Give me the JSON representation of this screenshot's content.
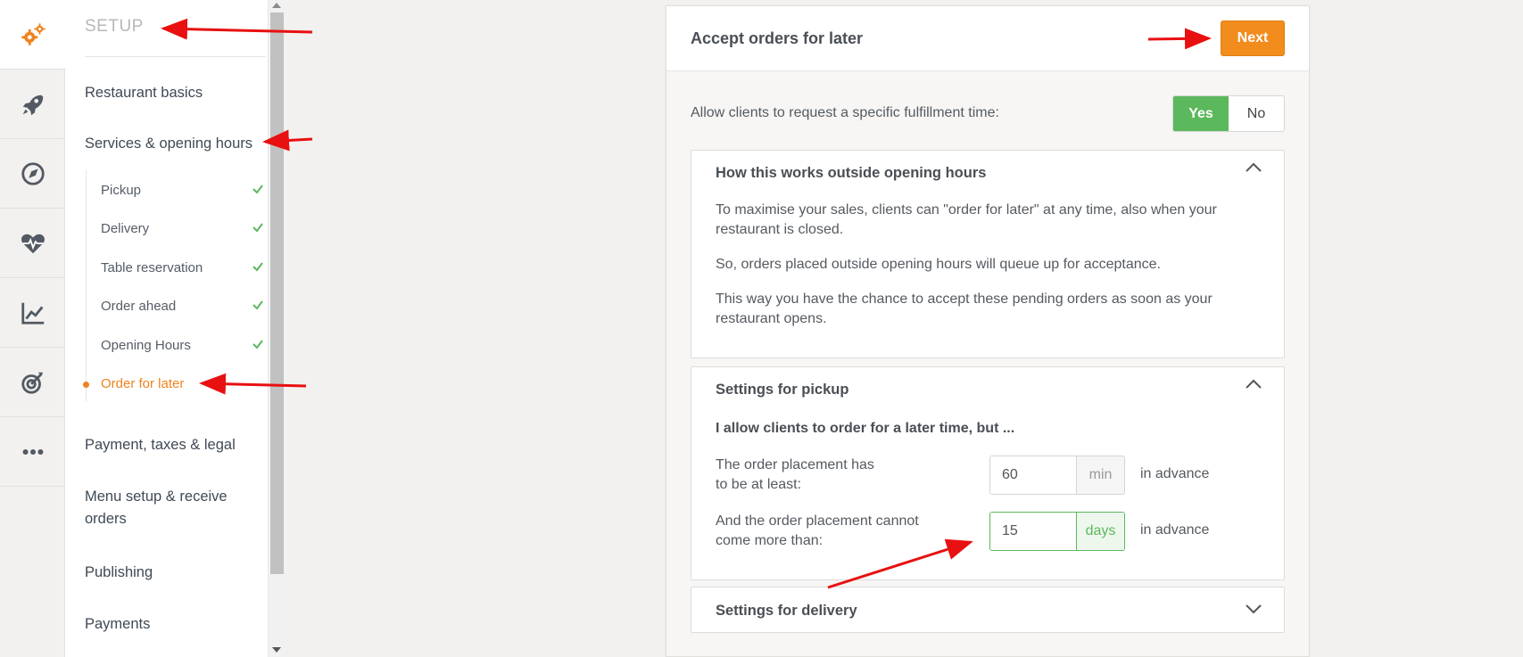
{
  "rail": {
    "items": [
      {
        "icon": "gears-icon",
        "active": true
      },
      {
        "icon": "rocket-icon",
        "active": false
      },
      {
        "icon": "compass-icon",
        "active": false
      },
      {
        "icon": "heartbeat-icon",
        "active": false
      },
      {
        "icon": "line-chart-icon",
        "active": false
      },
      {
        "icon": "target-icon",
        "active": false
      },
      {
        "icon": "more-dots-icon",
        "active": false
      }
    ]
  },
  "sidebar": {
    "title": "SETUP",
    "main_items": [
      "Restaurant basics",
      "Services & opening hours",
      "Payment, taxes & legal",
      "Menu setup & receive orders",
      "Publishing",
      "Payments"
    ],
    "sub_items": [
      {
        "label": "Pickup",
        "done": true
      },
      {
        "label": "Delivery",
        "done": true
      },
      {
        "label": "Table reservation",
        "done": true
      },
      {
        "label": "Order ahead",
        "done": true
      },
      {
        "label": "Opening Hours",
        "done": true
      },
      {
        "label": "Order for later",
        "done": false,
        "current": true
      }
    ]
  },
  "card": {
    "title": "Accept orders for later",
    "next_label": "Next",
    "allow_label": "Allow clients to request a specific fulfillment time:",
    "toggle": {
      "yes": "Yes",
      "no": "No",
      "selected": "Yes"
    },
    "info_panel": {
      "title": "How this works outside opening hours",
      "paragraphs": [
        "To maximise your sales, clients can \"order for later\" at any time, also when your restaurant is closed.",
        "So, orders placed outside opening hours will queue up for acceptance.",
        "This way you have the chance to accept these pending orders as soon as your restaurant opens."
      ]
    },
    "pickup_panel": {
      "title": "Settings for pickup",
      "subheading": "I allow clients to order for a later time, but ...",
      "min_label": "The order placement has to be at least:",
      "min_value": "60",
      "min_unit": "min",
      "max_label": "And the order placement cannot come more than:",
      "max_value": "15",
      "max_unit": "days",
      "advance_text": "in advance"
    },
    "delivery_panel": {
      "title": "Settings for delivery"
    }
  },
  "colors": {
    "accent": "#f28c1c",
    "success": "#5cb85c",
    "annotation": "#e81010"
  }
}
